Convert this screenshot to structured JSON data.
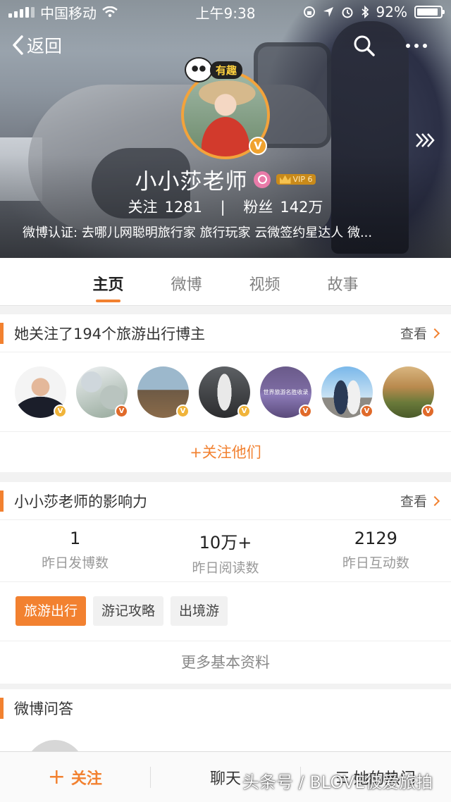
{
  "status_bar": {
    "carrier": "中国移动",
    "time": "上午9:38",
    "battery": "92%",
    "battery_level": 0.92
  },
  "nav": {
    "back_label": "返回"
  },
  "profile": {
    "badge": "有趣",
    "name": "小小莎老师",
    "vip": "VIP 6",
    "following_label": "关注",
    "following_count": "1281",
    "separator": "|",
    "fans_label": "粉丝",
    "fans_count": "142万",
    "verification": "微博认证: 去哪儿网聪明旅行家 旅行玩家 云微签约星达人 微..."
  },
  "tabs": [
    {
      "label": "主页",
      "active": true
    },
    {
      "label": "微博",
      "active": false
    },
    {
      "label": "视频",
      "active": false
    },
    {
      "label": "故事",
      "active": false
    }
  ],
  "followed_card": {
    "title": "她关注了194个旅游出行博主",
    "more": "查看",
    "action": "+关注他们",
    "avatars": [
      {
        "name": "avatar-1",
        "v_color": "#f0b43a"
      },
      {
        "name": "avatar-2",
        "v_color": "#e06a2a"
      },
      {
        "name": "avatar-3",
        "v_color": "#f0b43a"
      },
      {
        "name": "avatar-4",
        "v_color": "#f0b43a"
      },
      {
        "name": "avatar-5",
        "v_color": "#e06a2a"
      },
      {
        "name": "avatar-6",
        "v_color": "#e06a2a"
      },
      {
        "name": "avatar-7",
        "v_color": "#e06a2a"
      }
    ],
    "avatar5_text": "世界旅游名胜收录"
  },
  "influence_card": {
    "title": "小小莎老师的影响力",
    "more": "查看",
    "stats": [
      {
        "num": "1",
        "label": "昨日发博数"
      },
      {
        "num": "10万+",
        "label": "昨日阅读数"
      },
      {
        "num": "2129",
        "label": "昨日互动数"
      }
    ],
    "tags": [
      {
        "label": "旅游出行",
        "active": true
      },
      {
        "label": "游记攻略",
        "active": false
      },
      {
        "label": "出境游",
        "active": false
      }
    ],
    "more_info": "更多基本资料"
  },
  "qa_card": {
    "title": "微博问答"
  },
  "bottom_bar": {
    "follow": "关注",
    "chat": "聊天",
    "hot": "她的热门"
  },
  "watermark": "头条号 / BLOVE彼爱旅拍",
  "colors": {
    "accent": "#f28130",
    "vip_gold": "#f0a22e"
  }
}
